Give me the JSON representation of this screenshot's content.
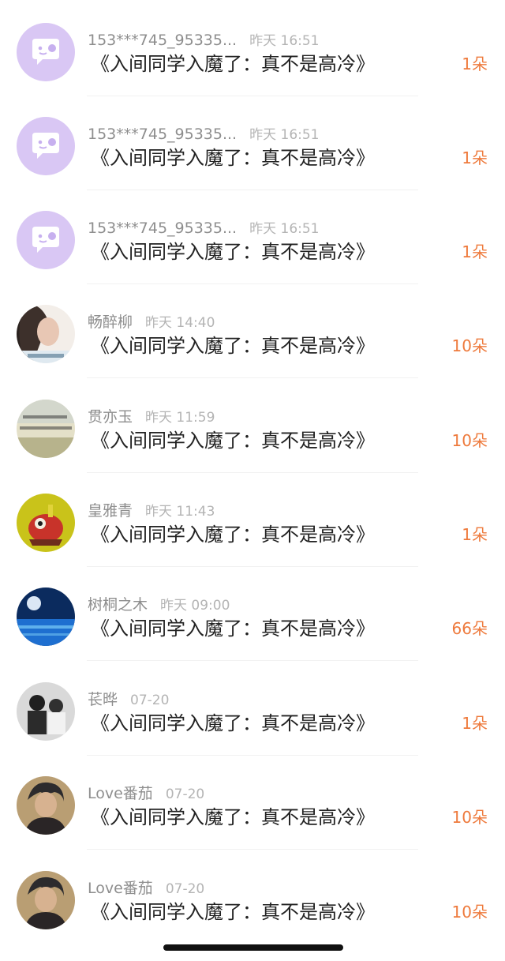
{
  "rows": [
    {
      "name": "153***745_95335...",
      "time": "昨天 16:51",
      "message": "《入间同学入魔了：真不是高冷》",
      "count": "1朵",
      "avatar": "default-chat-bubble-icon"
    },
    {
      "name": "153***745_95335...",
      "time": "昨天 16:51",
      "message": "《入间同学入魔了：真不是高冷》",
      "count": "1朵",
      "avatar": "default-chat-bubble-icon"
    },
    {
      "name": "153***745_95335...",
      "time": "昨天 16:51",
      "message": "《入间同学入魔了：真不是高冷》",
      "count": "1朵",
      "avatar": "default-chat-bubble-icon"
    },
    {
      "name": "畅醉柳",
      "time": "昨天 14:40",
      "message": "《入间同学入魔了：真不是高冷》",
      "count": "10朵",
      "avatar": "photo-avatar"
    },
    {
      "name": "贯亦玉",
      "time": "昨天 11:59",
      "message": "《入间同学入魔了：真不是高冷》",
      "count": "10朵",
      "avatar": "photo-avatar"
    },
    {
      "name": "皇雅青",
      "time": "昨天 11:43",
      "message": "《入间同学入魔了：真不是高冷》",
      "count": "1朵",
      "avatar": "photo-avatar"
    },
    {
      "name": "树桐之木",
      "time": "昨天 09:00",
      "message": "《入间同学入魔了：真不是高冷》",
      "count": "66朵",
      "avatar": "photo-avatar"
    },
    {
      "name": "苌晔",
      "time": "07-20",
      "message": "《入间同学入魔了：真不是高冷》",
      "count": "1朵",
      "avatar": "photo-avatar"
    },
    {
      "name": "Love番茄",
      "time": "07-20",
      "message": "《入间同学入魔了：真不是高冷》",
      "count": "10朵",
      "avatar": "photo-avatar"
    },
    {
      "name": "Love番茄",
      "time": "07-20",
      "message": "《入间同学入魔了：真不是高冷》",
      "count": "10朵",
      "avatar": "photo-avatar"
    }
  ],
  "colors": {
    "name": "#8e8e8e",
    "time": "#b4b4b4",
    "message": "#222222",
    "count": "#ee7a3c",
    "default_avatar_bg": "#d9c7f4"
  }
}
